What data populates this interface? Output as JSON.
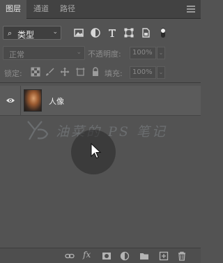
{
  "tabs": [
    {
      "label": "图层",
      "active": true
    },
    {
      "label": "通道",
      "active": false
    },
    {
      "label": "路径",
      "active": false
    }
  ],
  "filter": {
    "kind_label": "类型",
    "icons": [
      "pixel-filter-icon",
      "adjustment-filter-icon",
      "type-filter-icon",
      "shape-filter-icon",
      "smartobject-filter-icon",
      "filter-toggle-icon"
    ]
  },
  "blend": {
    "mode": "正常",
    "opacity_label": "不透明度:",
    "opacity_value": "100%"
  },
  "lock": {
    "label": "锁定:",
    "fill_label": "填充:",
    "fill_value": "100%",
    "icons": [
      "lock-transparent-icon",
      "lock-paint-icon",
      "lock-move-icon",
      "lock-artboard-icon",
      "lock-all-icon"
    ]
  },
  "layers": [
    {
      "name": "人像",
      "visible": true
    }
  ],
  "watermark": {
    "text": "油菜的 PS 笔记"
  },
  "bottom": {
    "fx_label": "fx",
    "icons": [
      "link-icon",
      "fx-icon",
      "mask-icon",
      "adjustment-icon",
      "group-folder-icon",
      "new-layer-icon",
      "trash-icon"
    ]
  }
}
